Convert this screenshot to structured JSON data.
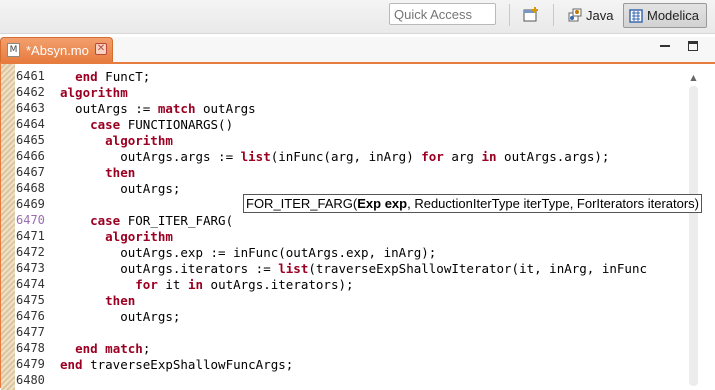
{
  "toolbar": {
    "quick_access_placeholder": "Quick Access",
    "perspectives": [
      {
        "label": "Java",
        "icon": "java-perspective-icon"
      },
      {
        "label": "Modelica",
        "icon": "modelica-perspective-icon",
        "active": true
      }
    ]
  },
  "editor_tab": {
    "title": "*Absyn.mo",
    "icon": "modelica-file-icon",
    "accent_color": "#e77c3f"
  },
  "code_colors": {
    "keyword": "#9b0023",
    "text": "#000000"
  },
  "current_line": 6470,
  "lines": [
    {
      "num": "6461",
      "segments": [
        {
          "t": "  "
        },
        {
          "t": "end",
          "k": true
        },
        {
          "t": " FuncT;"
        }
      ]
    },
    {
      "num": "6462",
      "segments": [
        {
          "t": "algorithm",
          "k": true
        }
      ]
    },
    {
      "num": "6463",
      "segments": [
        {
          "t": "  outArgs := "
        },
        {
          "t": "match",
          "k": true
        },
        {
          "t": " outArgs"
        }
      ]
    },
    {
      "num": "6464",
      "segments": [
        {
          "t": "    "
        },
        {
          "t": "case",
          "k": true
        },
        {
          "t": " FUNCTIONARGS()"
        }
      ]
    },
    {
      "num": "6465",
      "segments": [
        {
          "t": "      "
        },
        {
          "t": "algorithm",
          "k": true
        }
      ]
    },
    {
      "num": "6466",
      "segments": [
        {
          "t": "        outArgs.args := "
        },
        {
          "t": "list",
          "k": true
        },
        {
          "t": "(inFunc(arg, inArg) "
        },
        {
          "t": "for",
          "k": true
        },
        {
          "t": " arg "
        },
        {
          "t": "in",
          "k": true
        },
        {
          "t": " outArgs.args);"
        }
      ]
    },
    {
      "num": "6467",
      "segments": [
        {
          "t": "      "
        },
        {
          "t": "then",
          "k": true
        }
      ]
    },
    {
      "num": "6468",
      "segments": [
        {
          "t": "        outArgs;"
        }
      ]
    },
    {
      "num": "6469",
      "segments": [
        {
          "t": ""
        }
      ]
    },
    {
      "num": "6470",
      "segments": [
        {
          "t": "    "
        },
        {
          "t": "case",
          "k": true
        },
        {
          "t": " FOR_ITER_FARG("
        }
      ]
    },
    {
      "num": "6471",
      "segments": [
        {
          "t": "      "
        },
        {
          "t": "algorithm",
          "k": true
        }
      ]
    },
    {
      "num": "6472",
      "segments": [
        {
          "t": "        outArgs.exp := inFunc(outArgs.exp, inArg);"
        }
      ]
    },
    {
      "num": "6473",
      "segments": [
        {
          "t": "        outArgs.iterators := "
        },
        {
          "t": "list",
          "k": true
        },
        {
          "t": "(traverseExpShallowIterator(it, inArg, inFunc"
        }
      ]
    },
    {
      "num": "6474",
      "segments": [
        {
          "t": "          "
        },
        {
          "t": "for",
          "k": true
        },
        {
          "t": " it "
        },
        {
          "t": "in",
          "k": true
        },
        {
          "t": " outArgs.iterators);"
        }
      ]
    },
    {
      "num": "6475",
      "segments": [
        {
          "t": "      "
        },
        {
          "t": "then",
          "k": true
        }
      ]
    },
    {
      "num": "6476",
      "segments": [
        {
          "t": "        outArgs;"
        }
      ]
    },
    {
      "num": "6477",
      "segments": [
        {
          "t": ""
        }
      ]
    },
    {
      "num": "6478",
      "segments": [
        {
          "t": "  "
        },
        {
          "t": "end",
          "k": true
        },
        {
          "t": " "
        },
        {
          "t": "match",
          "k": true
        },
        {
          "t": ";"
        }
      ]
    },
    {
      "num": "6479",
      "segments": [
        {
          "t": "end",
          "k": true
        },
        {
          "t": " traverseExpShallowFuncArgs;"
        }
      ]
    },
    {
      "num": "6480",
      "segments": [
        {
          "t": ""
        }
      ]
    }
  ],
  "tooltip": {
    "name": "FOR_ITER_FARG(",
    "bold_part": "Exp exp",
    "rest": ", ReductionIterType iterType, ForIterators iterators)"
  }
}
